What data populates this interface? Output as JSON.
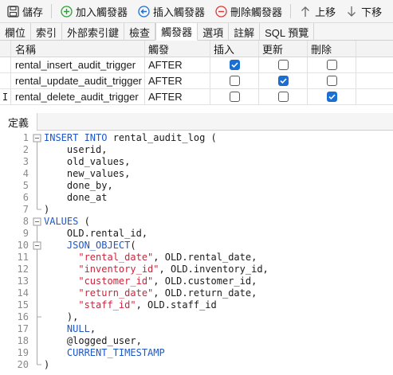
{
  "toolbar": {
    "save_label": "儲存",
    "add_label": "加入觸發器",
    "insert_label": "插入觸發器",
    "delete_label": "刪除觸發器",
    "move_up_label": "上移",
    "move_down_label": "下移"
  },
  "tabs": [
    "欄位",
    "索引",
    "外部索引鍵",
    "檢查",
    "觸發器",
    "選項",
    "註解",
    "SQL 預覽"
  ],
  "active_tab": "觸發器",
  "table": {
    "headers": [
      "名稱",
      "觸發",
      "插入",
      "更新",
      "刪除"
    ],
    "rows": [
      {
        "name": "rental_insert_audit_trigger",
        "fires": "AFTER",
        "insert": true,
        "update": false,
        "delete": false
      },
      {
        "name": "rental_update_audit_trigger",
        "fires": "AFTER",
        "insert": false,
        "update": true,
        "delete": false
      },
      {
        "name": "rental_delete_audit_trigger",
        "fires": "AFTER",
        "insert": false,
        "update": false,
        "delete": true
      }
    ],
    "current_row_marker": "I"
  },
  "definition_tab": "定義",
  "code_lines": [
    "INSERT INTO rental_audit_log (",
    "    userid,",
    "    old_values,",
    "    new_values,",
    "    done_by,",
    "    done_at",
    ")",
    "VALUES (",
    "    OLD.rental_id,",
    "    JSON_OBJECT(",
    "      \"rental_date\", OLD.rental_date,",
    "      \"inventory_id\", OLD.inventory_id,",
    "      \"customer_id\", OLD.customer_id,",
    "      \"return_date\", OLD.return_date,",
    "      \"staff_id\", OLD.staff_id",
    "    ),",
    "    NULL,",
    "    @logged_user,",
    "    CURRENT_TIMESTAMP",
    ")"
  ],
  "colors": {
    "keyword": "#1f57c7",
    "string": "#c9263b",
    "checkbox_checked": "#1a6fd1",
    "add_icon": "#2e9e3a",
    "insert_icon": "#1f6fd0",
    "delete_icon": "#d23b3b"
  },
  "icons": {
    "save": "save-icon",
    "add": "plus-circle-icon",
    "insert": "arrow-left-circle-icon",
    "delete": "minus-circle-icon",
    "up": "arrow-up-icon",
    "down": "arrow-down-icon"
  }
}
